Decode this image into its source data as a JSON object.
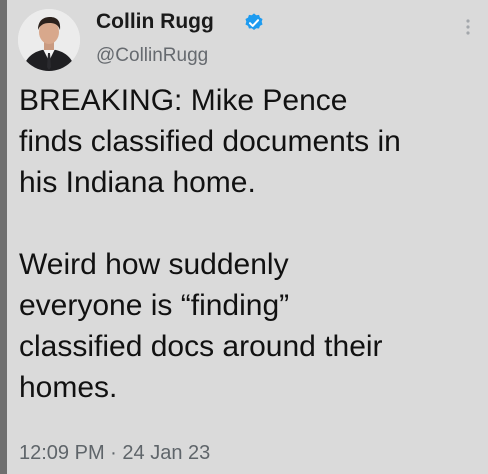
{
  "author": {
    "display_name": "Collin Rugg",
    "handle": "@CollinRugg",
    "avatar_icon": "profile-photo",
    "verified_icon": "verified-badge-icon",
    "verified_color": "#1d9bf0"
  },
  "tweet": {
    "text": "BREAKING: Mike Pence\nfinds classified documents in\nhis Indiana home.\n\nWeird how suddenly\neveryone is “finding”\nclassified docs around their\nhomes.",
    "time": "12:09 PM",
    "separator": "·",
    "date": "24 Jan 23"
  },
  "menu": {
    "more_icon": "more-vertical-icon"
  }
}
